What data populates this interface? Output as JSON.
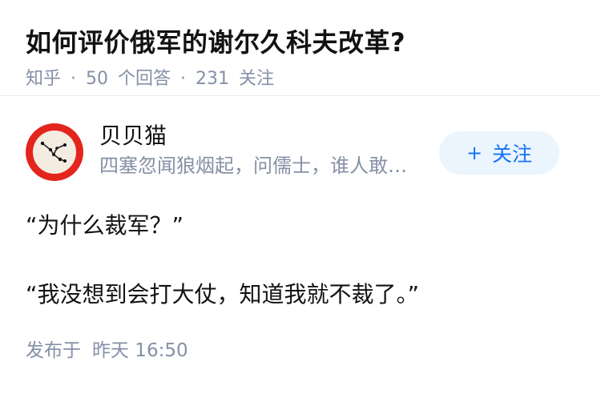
{
  "question": {
    "title": "如何评价俄军的谢尔久科夫改革?",
    "source": "知乎",
    "answer_count": "50",
    "answer_label": "个回答",
    "follower_count": "231",
    "follower_label": "关注",
    "separator": "·"
  },
  "answer": {
    "author": {
      "name": "贝贝猫",
      "headline": "四塞忽闻狼烟起，问儒士，谁人敢…",
      "avatar_icon": "constellation-avatar-icon"
    },
    "follow_button": {
      "plus": "+",
      "label": "关注"
    },
    "paragraphs": [
      "“为什么裁军？”",
      "“我没想到会打大仗，知道我就不裁了。”"
    ],
    "published": {
      "label": "发布于",
      "time": "昨天 16:50"
    }
  },
  "colors": {
    "meta_gray": "#8590a6",
    "follow_bg": "#ebf5fd",
    "follow_text": "#1772f6",
    "avatar_ring": "#e3251e"
  }
}
